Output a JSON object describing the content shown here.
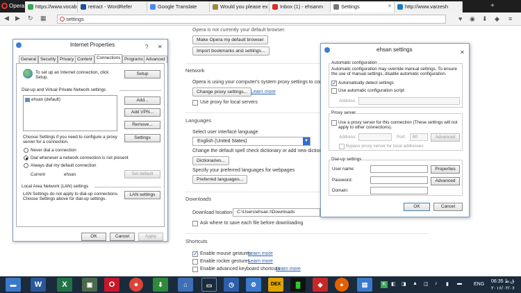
{
  "browser": {
    "menu_label": "Opera",
    "tabs": [
      {
        "label": "https://www.vocab",
        "color": "#3aa757"
      },
      {
        "label": "retract - WordRefer",
        "color": "#1f4f9a"
      },
      {
        "label": "Google Translate",
        "color": "#4a8af4"
      },
      {
        "label": "Would you please ex",
        "color": "#9b8b3a"
      },
      {
        "label": "Inbox (1) - ehsanm",
        "color": "#d93025"
      },
      {
        "label": "Settings",
        "color": "#777777"
      },
      {
        "label": "http://www.varzesh",
        "color": "#1a7abf"
      }
    ],
    "new_tab": "+",
    "address": "settings"
  },
  "settings": {
    "default_browser_text": "Opera is not currently your default browser.",
    "make_default_button": "Make Opera my default browser",
    "import_button": "Import bookmarks and settings...",
    "network_heading": "Network",
    "proxy_text": "Opera is using your computer's system proxy settings to connect to the network.",
    "change_proxy_button": "Change proxy settings...",
    "learn_more": "Learn more",
    "proxy_local_label": "Use proxy for local servers",
    "languages_heading": "Languages",
    "select_language_label": "Select user interface language",
    "language_value": "English (United States)",
    "spellcheck_text": "Change the default spell check dictionary or add new dictionaries",
    "dictionaries_button": "Dictionaries...",
    "preferred_lang_text": "Specify your preferred languages for webpages",
    "preferred_lang_button": "Preferred languages...",
    "downloads_heading": "Downloads",
    "download_location_label": "Download location:",
    "download_location_value": "C:\\Users\\ehsan l\\Downloads",
    "ask_save_label": "Ask where to save each file before downloading",
    "shortcuts_heading": "Shortcuts",
    "mouse_gestures_label": "Enable mouse gestures",
    "rocker_gestures_label": "Enable rocker gestures",
    "keyboard_shortcuts_label": "Enable advanced keyboard shortcuts"
  },
  "internet_properties": {
    "title": "Internet Properties",
    "close": "✕",
    "help": "?",
    "tabs": [
      "General",
      "Security",
      "Privacy",
      "Content",
      "Connections",
      "Programs",
      "Advanced"
    ],
    "setup_text": "To set up an Internet connection, click Setup.",
    "setup_button": "Setup",
    "dialup_group": "Dial-up and Virtual Private Network settings",
    "connection_item": "ehsan (default)",
    "add_button": "Add...",
    "add_vpn_button": "Add VPN...",
    "remove_button": "Remove...",
    "choose_settings_text": "Choose Settings if you need to configure a proxy server for a connection.",
    "settings_button": "Settings",
    "radio_never": "Never dial a connection",
    "radio_whenever": "Dial whenever a network connection is not present",
    "radio_always": "Always dial my default connection",
    "current_label": "Current",
    "current_value": "ehsan",
    "set_default_button": "Set default",
    "lan_group": "Local Area Network (LAN) settings",
    "lan_text": "LAN Settings do not apply to dial-up connections. Choose Settings above for dial-up settings.",
    "lan_button": "LAN settings",
    "ok_button": "OK",
    "cancel_button": "Cancel",
    "apply_button": "Apply"
  },
  "ehsan_settings": {
    "title": "ehsan settings",
    "close": "✕",
    "auto_config_group": "Automatic configuration",
    "auto_config_text": "Automatic configuration may override manual settings. To ensure the use of manual settings, disable automatic configuration.",
    "auto_detect_label": "Automatically detect settings",
    "auto_script_label": "Use automatic configuration script",
    "address_label": "Address",
    "proxy_group": "Proxy server",
    "use_proxy_label": "Use a proxy server for this connection (These settings will not apply to other connections).",
    "proxy_address_label": "Address:",
    "port_label": "Port:",
    "port_value": "80",
    "advanced_button": "Advanced",
    "bypass_label": "Bypass proxy server for local addresses",
    "dialup_group": "Dial-up settings",
    "username_label": "User name:",
    "password_label": "Password:",
    "domain_label": "Domain:",
    "properties_button": "Properties",
    "advanced2_button": "Advanced",
    "ok_button": "OK",
    "cancel_button": "Cancel"
  },
  "taskbar": {
    "language": "ENG",
    "time": "06:35 ق.ظ",
    "date": "۲۰۱۶/۰۲/۰۶"
  }
}
